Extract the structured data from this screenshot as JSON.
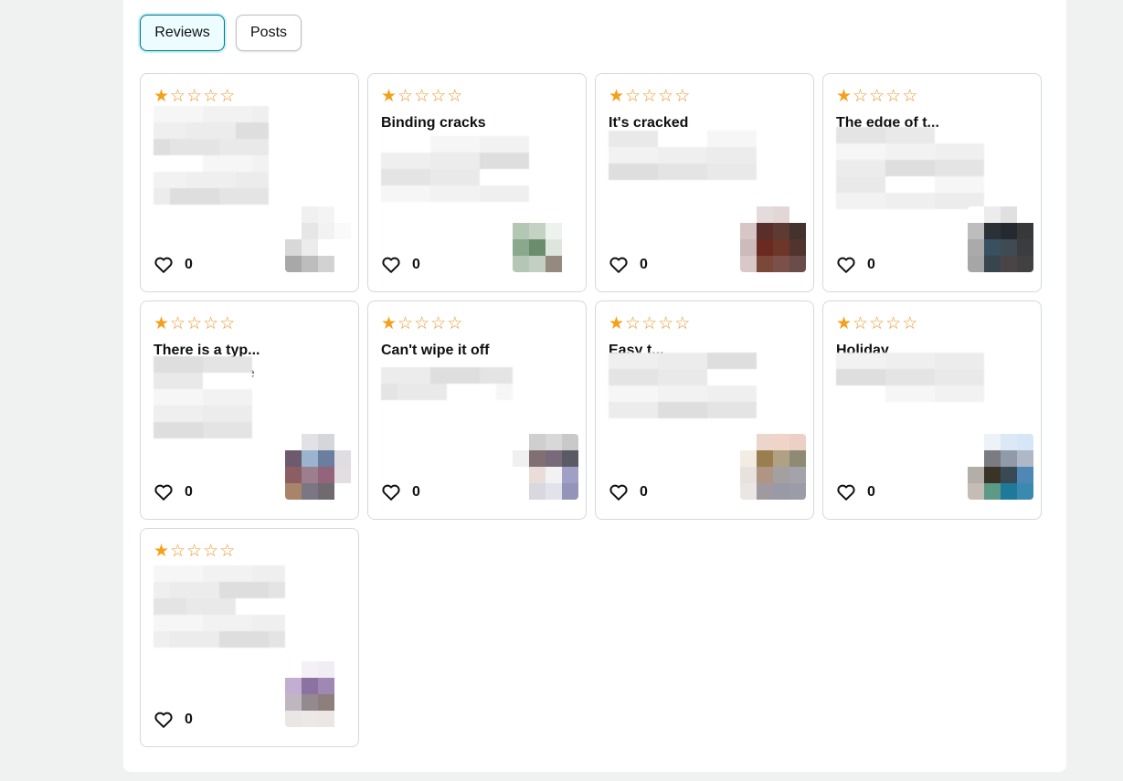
{
  "tabs": [
    {
      "label": "Reviews",
      "active": true
    },
    {
      "label": "Posts",
      "active": false
    }
  ],
  "colors": {
    "star": "#f5a01a",
    "active_tab_border": "#007185",
    "active_tab_bg": "#edfdff",
    "card_border": "#d5d9d9"
  },
  "reviews": [
    {
      "rating": 1,
      "title": "",
      "snippet": "calc",
      "helpful_count": "0",
      "thumb": [
        "#ffffff",
        "#f0f0f0",
        "#f4f4f4",
        "#ffffff",
        "#ffffff",
        "#e6e6e6",
        "#f2f2f2",
        "#fafafa",
        "#d8d8d8",
        "#ececec",
        "#ffffff",
        "#ffffff",
        "#a8a8a8",
        "#bdbdbd",
        "#d2d2d2",
        "#ffffff"
      ]
    },
    {
      "rating": 1,
      "title": "Binding cracks",
      "snippet": "",
      "helpful_count": "0",
      "thumb": [
        "#ffffff",
        "#ffffff",
        "#ffffff",
        "#ffffff",
        "#b4c6b4",
        "#c4d2c4",
        "#eef2ee",
        "#ffffff",
        "#8aa88c",
        "#6a8e6c",
        "#dde6dd",
        "#ffffff",
        "#b5c6b5",
        "#c2cfc2",
        "#968a80",
        "#ffffff"
      ]
    },
    {
      "rating": 1,
      "title": "It's cracked",
      "snippet": "",
      "helpful_count": "0",
      "thumb": [
        "#ffffff",
        "#e4dcdc",
        "#e2d6d6",
        "#ffffff",
        "#d6c6c6",
        "#5a2e2a",
        "#5e3a34",
        "#43322e",
        "#cdbaba",
        "#6a2a22",
        "#6e3628",
        "#52342e",
        "#d8c8c8",
        "#7a4838",
        "#7a5048",
        "#6a4c48"
      ]
    },
    {
      "rating": 1,
      "title": "The edge of t...",
      "snippet": "",
      "helpful_count": "0",
      "thumb": [
        "#ffffff",
        "#ececec",
        "#e0e0e0",
        "#ffffff",
        "#bdbdbd",
        "#2a3238",
        "#242a30",
        "#36383a",
        "#aaaaaa",
        "#385060",
        "#404a52",
        "#3a3c40",
        "#a6a6a6",
        "#38444e",
        "#4a4446",
        "#424040"
      ]
    },
    {
      "rating": 1,
      "title": "There is a typ...",
      "snippet": "he",
      "helpful_count": "0",
      "thumb": [
        "#ffffff",
        "#e2e2e6",
        "#d4d6da",
        "#ffffff",
        "#6e5a6e",
        "#9ab4d0",
        "#6a7ea0",
        "#e0dde2",
        "#8a5e62",
        "#9c7e8e",
        "#94647a",
        "#e2dee2",
        "#a8846a",
        "#7a7684",
        "#6e6a70",
        "#ffffff"
      ]
    },
    {
      "rating": 1,
      "title": "Can't wipe it off",
      "snippet": "",
      "helpful_count": "0",
      "thumb": [
        "#ffffff",
        "#cfcfcf",
        "#d8d8d8",
        "#c9c9c9",
        "#f0f0f0",
        "#807074",
        "#786a7a",
        "#5a5a64",
        "#ffffff",
        "#eadcd8",
        "#f2f2f2",
        "#a0a0c6",
        "#ffffff",
        "#d8d8de",
        "#e2e2ea",
        "#9494b8"
      ]
    },
    {
      "rating": 1,
      "title": "Easy t...",
      "snippet": "",
      "helpful_count": "0",
      "thumb": [
        "#ffffff",
        "#ecd6cc",
        "#f0d4c8",
        "#ecd0c6",
        "#f2ece4",
        "#9a7e50",
        "#b0a084",
        "#8e8a74",
        "#e8e2de",
        "#b09484",
        "#a4a0a0",
        "#a4a2aa",
        "#eae6e4",
        "#a09aa0",
        "#9a9aa6",
        "#9a9ca8"
      ]
    },
    {
      "rating": 1,
      "title": "Holiday",
      "snippet": "",
      "helpful_count": "0",
      "thumb": [
        "#ffffff",
        "#ecf2f8",
        "#dce8f6",
        "#d6e6f6",
        "#ffffff",
        "#7a7c82",
        "#909aa8",
        "#aeb8c6",
        "#b4aea8",
        "#3a3428",
        "#3a4a54",
        "#4e88b4",
        "#c6bcb6",
        "#5c9a86",
        "#1e7a9a",
        "#3a8ab0"
      ]
    },
    {
      "rating": 1,
      "title": "",
      "snippet": "",
      "helpful_count": "0",
      "thumb": [
        "#ffffff",
        "#f4f0f6",
        "#f0eef4",
        "#ffffff",
        "#c2aed0",
        "#8c72a0",
        "#a088b4",
        "#ffffff",
        "#c0b6c2",
        "#938a90",
        "#8e7e7c",
        "#ffffff",
        "#eae6e4",
        "#ece8e6",
        "#ebe7e4",
        "#ffffff"
      ]
    }
  ]
}
